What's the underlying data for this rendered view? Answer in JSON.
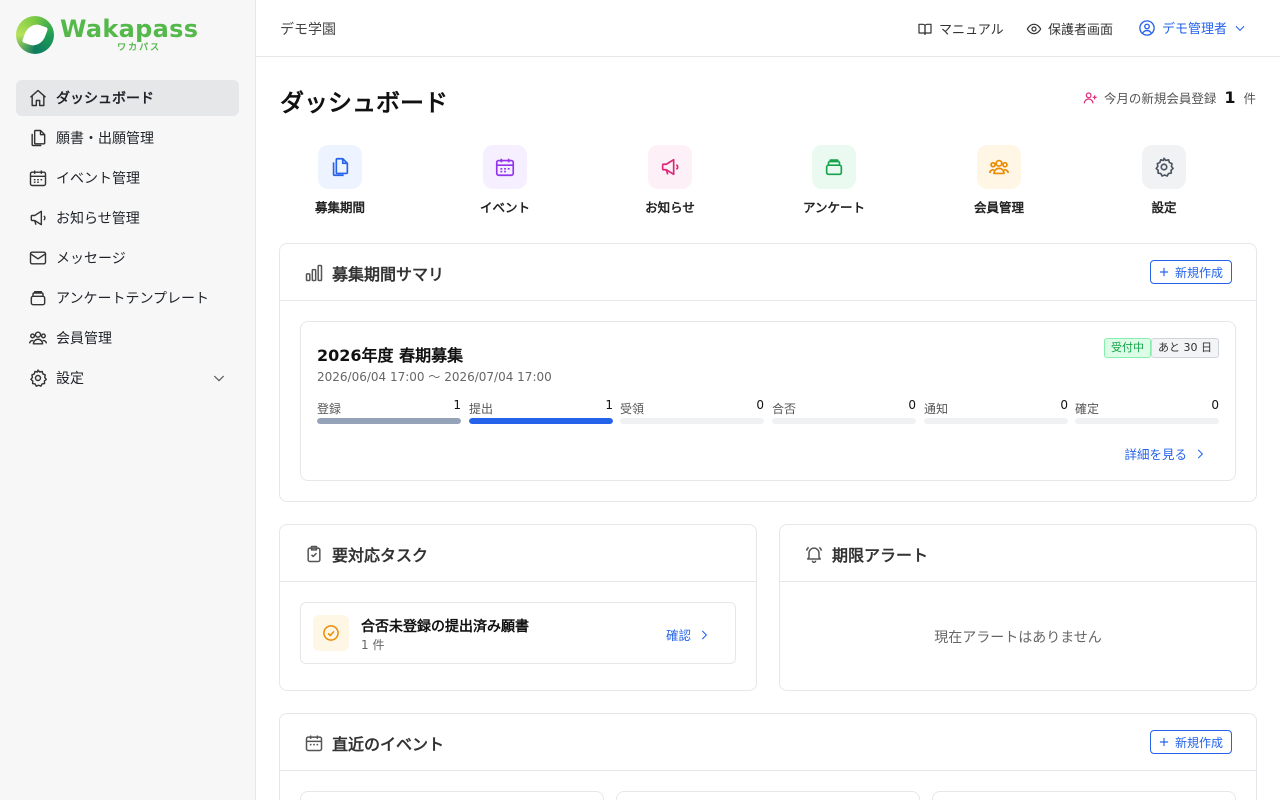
{
  "brand": {
    "name": "Wakapass",
    "kana": "ワカパス"
  },
  "sidebar": {
    "items": [
      {
        "label": "ダッシュボード",
        "icon": "home-icon",
        "active": true
      },
      {
        "label": "願書・出願管理",
        "icon": "documents-icon"
      },
      {
        "label": "イベント管理",
        "icon": "calendar-icon"
      },
      {
        "label": "お知らせ管理",
        "icon": "megaphone-icon"
      },
      {
        "label": "メッセージ",
        "icon": "mail-icon"
      },
      {
        "label": "アンケートテンプレート",
        "icon": "stack-icon"
      },
      {
        "label": "会員管理",
        "icon": "users-icon"
      },
      {
        "label": "設定",
        "icon": "gear-icon",
        "expandable": true
      }
    ]
  },
  "header": {
    "school": "デモ学園",
    "manual": "マニュアル",
    "guardian_view": "保護者画面",
    "user": "デモ管理者"
  },
  "page": {
    "title": "ダッシュボード",
    "new_members_label": "今月の新規会員登録",
    "new_members_count": "1",
    "new_members_unit": "件"
  },
  "quick_actions": [
    {
      "label": "募集期間",
      "icon": "documents-icon",
      "color": "#2563eb",
      "bg": "#eef4ff"
    },
    {
      "label": "イベント",
      "icon": "calendar-icon",
      "color": "#9333ea",
      "bg": "#f6efff"
    },
    {
      "label": "お知らせ",
      "icon": "megaphone-icon",
      "color": "#db2777",
      "bg": "#fdf0f6"
    },
    {
      "label": "アンケート",
      "icon": "stack-icon",
      "color": "#16a34a",
      "bg": "#eafaf0"
    },
    {
      "label": "会員管理",
      "icon": "users-icon",
      "color": "#ea8a00",
      "bg": "#fff6e6"
    },
    {
      "label": "設定",
      "icon": "gear-icon",
      "color": "#4b5563",
      "bg": "#f1f2f4"
    }
  ],
  "summary": {
    "title": "募集期間サマリ",
    "new_button": "新規作成",
    "period": {
      "name": "2026年度 春期募集",
      "range": "2026/06/04 17:00 〜 2026/07/04 17:00",
      "status_badge": "受付中",
      "remaining_badge": "あと 30 日",
      "stages": [
        {
          "label": "登録",
          "count": "1",
          "fill": 1.0,
          "color": "#94a3b8"
        },
        {
          "label": "提出",
          "count": "1",
          "fill": 1.0,
          "color": "#2563eb"
        },
        {
          "label": "受領",
          "count": "0",
          "fill": 0,
          "color": "#2563eb"
        },
        {
          "label": "合否",
          "count": "0",
          "fill": 0,
          "color": "#2563eb"
        },
        {
          "label": "通知",
          "count": "0",
          "fill": 0,
          "color": "#2563eb"
        },
        {
          "label": "確定",
          "count": "0",
          "fill": 0,
          "color": "#2563eb"
        }
      ],
      "detail_link": "詳細を見る"
    }
  },
  "tasks": {
    "title": "要対応タスク",
    "items": [
      {
        "title": "合否未登録の提出済み願書",
        "count": "1 件",
        "action": "確認"
      }
    ]
  },
  "alerts": {
    "title": "期限アラート",
    "empty": "現在アラートはありません"
  },
  "events": {
    "title": "直近のイベント",
    "new_button": "新規作成"
  },
  "colors": {
    "accent": "#2563eb",
    "brand": "#55b84a"
  }
}
